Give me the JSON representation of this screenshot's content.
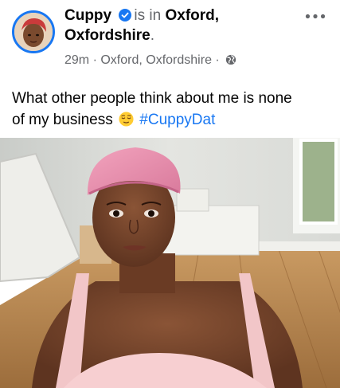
{
  "post": {
    "author": "Cuppy",
    "is_in": "is in",
    "place_line1": "Oxford,",
    "place_line2": "Oxfordshire",
    "place_end": ".",
    "time": "29m",
    "separator": "·",
    "location": "Oxford, Oxfordshire",
    "separator2": "·",
    "privacy_icon": "globe-icon",
    "text_line1": "What other people think about me is none",
    "text_line2": "of my business",
    "emoji": "relieved-face-emoji",
    "hashtag": "#CuppyDat"
  },
  "colors": {
    "link_blue": "#1877f2",
    "meta_gray": "#65676b",
    "text": "#050505"
  },
  "photo": {
    "subject": "selfie-photo"
  }
}
